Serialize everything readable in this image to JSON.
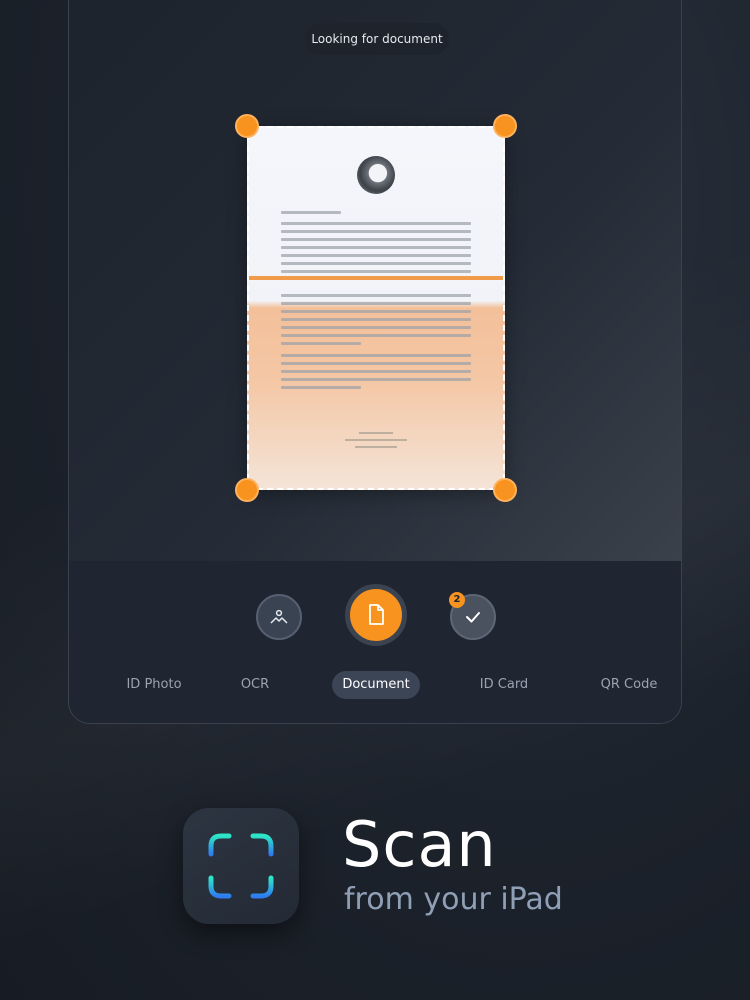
{
  "camera": {
    "status_text": "Looking for document"
  },
  "capture_controls": {
    "gallery_icon": "gallery-icon",
    "shutter_icon": "document-icon",
    "done_icon": "check-icon",
    "done_count": "2"
  },
  "modes": [
    {
      "label": "ID Photo"
    },
    {
      "label": "OCR"
    },
    {
      "label": "Document"
    },
    {
      "label": "ID Card"
    },
    {
      "label": "QR Code"
    }
  ],
  "selected_mode": "Document",
  "promo": {
    "headline": "Scan",
    "subline": "from your iPad"
  },
  "colors": {
    "accent": "#f7931e",
    "icon_gradient_top": "#2ee6c6",
    "icon_gradient_bottom": "#2f7df0"
  }
}
